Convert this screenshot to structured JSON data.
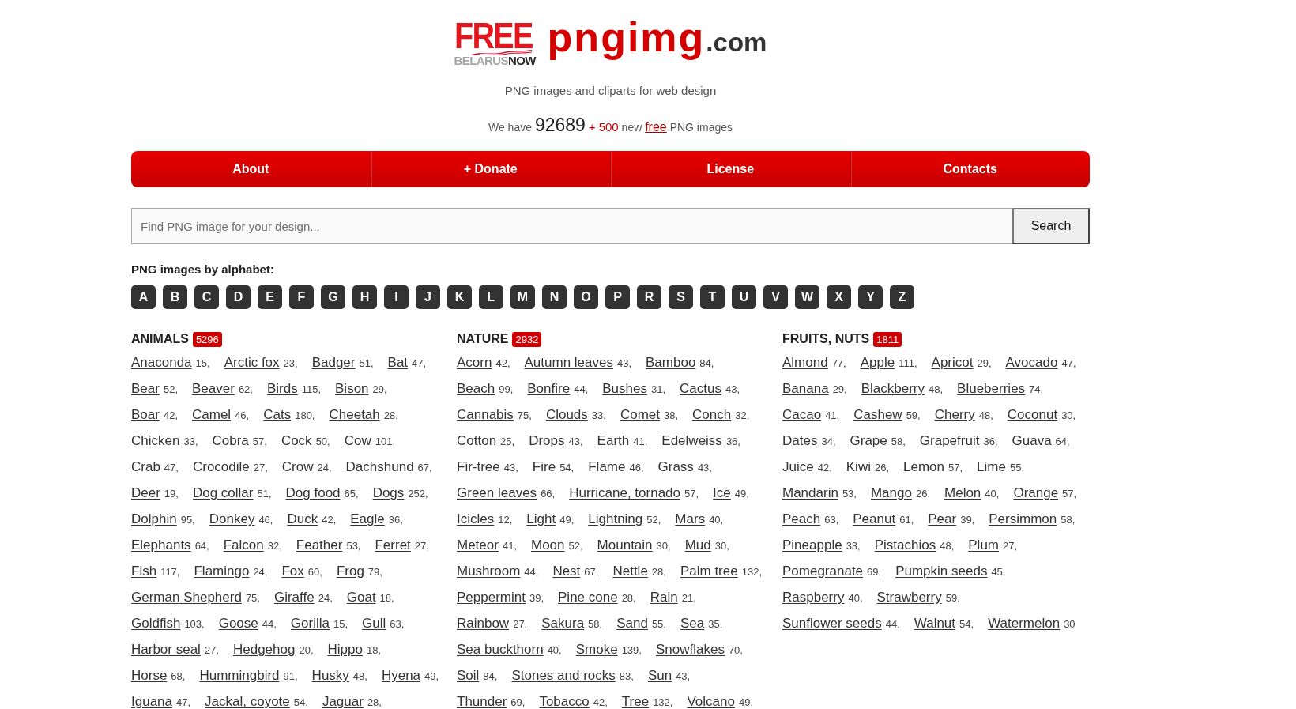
{
  "logo": {
    "badge_top": "FREE",
    "badge_light": "BELARUS",
    "badge_bold": "NOW",
    "name": "pngimg",
    "domain": ".com"
  },
  "tagline": "PNG images and cliparts for web design",
  "stats": [
    {
      "kind": "text",
      "text": "We have"
    },
    {
      "kind": "total",
      "text": "92689"
    },
    {
      "kind": "added",
      "text": "+ 500"
    },
    {
      "kind": "text",
      "text": "new"
    },
    {
      "kind": "link",
      "text": "free"
    },
    {
      "kind": "text",
      "text": "PNG images"
    }
  ],
  "nav": [
    "About",
    "+ Donate",
    "License",
    "Contacts"
  ],
  "search": {
    "placeholder": "Find PNG image for your design...",
    "button": "Search"
  },
  "alphabet": {
    "title": "PNG images by alphabet:",
    "letters": [
      "A",
      "B",
      "C",
      "D",
      "E",
      "F",
      "G",
      "H",
      "I",
      "J",
      "K",
      "L",
      "M",
      "N",
      "O",
      "P",
      "R",
      "S",
      "T",
      "U",
      "V",
      "W",
      "X",
      "Y",
      "Z"
    ]
  },
  "categories": [
    {
      "title": "ANIMALS",
      "count": "5296",
      "items": [
        {
          "name": "Anaconda",
          "count": "15,"
        },
        {
          "name": "Arctic fox",
          "count": "23,"
        },
        {
          "name": "Badger",
          "count": "51,"
        },
        {
          "name": "Bat",
          "count": "47,"
        },
        {
          "name": "Bear",
          "count": "52,"
        },
        {
          "name": "Beaver",
          "count": "62,"
        },
        {
          "name": "Birds",
          "count": "115,"
        },
        {
          "name": "Bison",
          "count": "29,"
        },
        {
          "name": "Boar",
          "count": "42,"
        },
        {
          "name": "Camel",
          "count": "46,"
        },
        {
          "name": "Cats",
          "count": "180,"
        },
        {
          "name": "Cheetah",
          "count": "28,"
        },
        {
          "name": "Chicken",
          "count": "33,"
        },
        {
          "name": "Cobra",
          "count": "57,"
        },
        {
          "name": "Cock",
          "count": "50,"
        },
        {
          "name": "Cow",
          "count": "101,"
        },
        {
          "name": "Crab",
          "count": "47,"
        },
        {
          "name": "Crocodile",
          "count": "27,"
        },
        {
          "name": "Crow",
          "count": "24,"
        },
        {
          "name": "Dachshund",
          "count": "67,"
        },
        {
          "name": "Deer",
          "count": "19,"
        },
        {
          "name": "Dog collar",
          "count": "51,"
        },
        {
          "name": "Dog food",
          "count": "65,"
        },
        {
          "name": "Dogs",
          "count": "252,"
        },
        {
          "name": "Dolphin",
          "count": "95,"
        },
        {
          "name": "Donkey",
          "count": "46,"
        },
        {
          "name": "Duck",
          "count": "42,"
        },
        {
          "name": "Eagle",
          "count": "36,"
        },
        {
          "name": "Elephants",
          "count": "64,"
        },
        {
          "name": "Falcon",
          "count": "32,"
        },
        {
          "name": "Feather",
          "count": "53,"
        },
        {
          "name": "Ferret",
          "count": "27,"
        },
        {
          "name": "Fish",
          "count": "117,"
        },
        {
          "name": "Flamingo",
          "count": "24,"
        },
        {
          "name": "Fox",
          "count": "60,"
        },
        {
          "name": "Frog",
          "count": "79,"
        },
        {
          "name": "German Shepherd",
          "count": "75,"
        },
        {
          "name": "Giraffe",
          "count": "24,"
        },
        {
          "name": "Goat",
          "count": "18,"
        },
        {
          "name": "Goldfish",
          "count": "103,"
        },
        {
          "name": "Goose",
          "count": "44,"
        },
        {
          "name": "Gorilla",
          "count": "15,"
        },
        {
          "name": "Gull",
          "count": "63,"
        },
        {
          "name": "Harbor seal",
          "count": "27,"
        },
        {
          "name": "Hedgehog",
          "count": "20,"
        },
        {
          "name": "Hippo",
          "count": "18,"
        },
        {
          "name": "Horse",
          "count": "68,"
        },
        {
          "name": "Hummingbird",
          "count": "91,"
        },
        {
          "name": "Husky",
          "count": "48,"
        },
        {
          "name": "Hyena",
          "count": "49,"
        },
        {
          "name": "Iguana",
          "count": "47,"
        },
        {
          "name": "Jackal, coyote",
          "count": "54,"
        },
        {
          "name": "Jaguar",
          "count": "28,"
        }
      ]
    },
    {
      "title": "NATURE",
      "count": "2932",
      "items": [
        {
          "name": "Acorn",
          "count": "42,"
        },
        {
          "name": "Autumn leaves",
          "count": "43,"
        },
        {
          "name": "Bamboo",
          "count": "84,"
        },
        {
          "name": "Beach",
          "count": "99,"
        },
        {
          "name": "Bonfire",
          "count": "44,"
        },
        {
          "name": "Bushes",
          "count": "31,"
        },
        {
          "name": "Cactus",
          "count": "43,"
        },
        {
          "name": "Cannabis",
          "count": "75,"
        },
        {
          "name": "Clouds",
          "count": "33,"
        },
        {
          "name": "Comet",
          "count": "38,"
        },
        {
          "name": "Conch",
          "count": "32,"
        },
        {
          "name": "Cotton",
          "count": "25,"
        },
        {
          "name": "Drops",
          "count": "43,"
        },
        {
          "name": "Earth",
          "count": "41,"
        },
        {
          "name": "Edelweiss",
          "count": "36,"
        },
        {
          "name": "Fir-tree",
          "count": "43,"
        },
        {
          "name": "Fire",
          "count": "54,"
        },
        {
          "name": "Flame",
          "count": "46,"
        },
        {
          "name": "Grass",
          "count": "43,"
        },
        {
          "name": "Green leaves",
          "count": "66,"
        },
        {
          "name": "Hurricane, tornado",
          "count": "57,"
        },
        {
          "name": "Ice",
          "count": "49,"
        },
        {
          "name": "Icicles",
          "count": "12,"
        },
        {
          "name": "Light",
          "count": "49,"
        },
        {
          "name": "Lightning",
          "count": "52,"
        },
        {
          "name": "Mars",
          "count": "40,"
        },
        {
          "name": "Meteor",
          "count": "41,"
        },
        {
          "name": "Moon",
          "count": "52,"
        },
        {
          "name": "Mountain",
          "count": "30,"
        },
        {
          "name": "Mud",
          "count": "30,"
        },
        {
          "name": "Mushroom",
          "count": "44,"
        },
        {
          "name": "Nest",
          "count": "67,"
        },
        {
          "name": "Nettle",
          "count": "28,"
        },
        {
          "name": "Palm tree",
          "count": "132,"
        },
        {
          "name": "Peppermint",
          "count": "39,"
        },
        {
          "name": "Pine cone",
          "count": "28,"
        },
        {
          "name": "Rain",
          "count": "21,"
        },
        {
          "name": "Rainbow",
          "count": "27,"
        },
        {
          "name": "Sakura",
          "count": "58,"
        },
        {
          "name": "Sand",
          "count": "55,"
        },
        {
          "name": "Sea",
          "count": "35,"
        },
        {
          "name": "Sea buckthorn",
          "count": "40,"
        },
        {
          "name": "Smoke",
          "count": "139,"
        },
        {
          "name": "Snowflakes",
          "count": "70,"
        },
        {
          "name": "Soil",
          "count": "84,"
        },
        {
          "name": "Stones and rocks",
          "count": "83,"
        },
        {
          "name": "Sun",
          "count": "43,"
        },
        {
          "name": "Thunder",
          "count": "69,"
        },
        {
          "name": "Tobacco",
          "count": "42,"
        },
        {
          "name": "Tree",
          "count": "132,"
        },
        {
          "name": "Volcano",
          "count": "49,"
        }
      ]
    },
    {
      "title": "FRUITS, NUTS",
      "count": "1811",
      "items": [
        {
          "name": "Almond",
          "count": "77,"
        },
        {
          "name": "Apple",
          "count": "111,"
        },
        {
          "name": "Apricot",
          "count": "29,"
        },
        {
          "name": "Avocado",
          "count": "47,"
        },
        {
          "name": "Banana",
          "count": "29,"
        },
        {
          "name": "Blackberry",
          "count": "48,"
        },
        {
          "name": "Blueberries",
          "count": "74,"
        },
        {
          "name": "Cacao",
          "count": "41,"
        },
        {
          "name": "Cashew",
          "count": "59,"
        },
        {
          "name": "Cherry",
          "count": "48,"
        },
        {
          "name": "Coconut",
          "count": "30,"
        },
        {
          "name": "Dates",
          "count": "34,"
        },
        {
          "name": "Grape",
          "count": "58,"
        },
        {
          "name": "Grapefruit",
          "count": "36,"
        },
        {
          "name": "Guava",
          "count": "64,"
        },
        {
          "name": "Juice",
          "count": "42,"
        },
        {
          "name": "Kiwi",
          "count": "26,"
        },
        {
          "name": "Lemon",
          "count": "57,"
        },
        {
          "name": "Lime",
          "count": "55,"
        },
        {
          "name": "Mandarin",
          "count": "53,"
        },
        {
          "name": "Mango",
          "count": "26,"
        },
        {
          "name": "Melon",
          "count": "40,"
        },
        {
          "name": "Orange",
          "count": "57,"
        },
        {
          "name": "Peach",
          "count": "63,"
        },
        {
          "name": "Peanut",
          "count": "61,"
        },
        {
          "name": "Pear",
          "count": "39,"
        },
        {
          "name": "Persimmon",
          "count": "58,"
        },
        {
          "name": "Pineapple",
          "count": "33,"
        },
        {
          "name": "Pistachios",
          "count": "48,"
        },
        {
          "name": "Plum",
          "count": "27,"
        },
        {
          "name": "Pomegranate",
          "count": "69,"
        },
        {
          "name": "Pumpkin seeds",
          "count": "45,"
        },
        {
          "name": "Raspberry",
          "count": "40,"
        },
        {
          "name": "Strawberry",
          "count": "59,"
        },
        {
          "name": "Sunflower seeds",
          "count": "44,"
        },
        {
          "name": "Walnut",
          "count": "54,"
        },
        {
          "name": "Watermelon",
          "count": "30"
        }
      ]
    }
  ]
}
